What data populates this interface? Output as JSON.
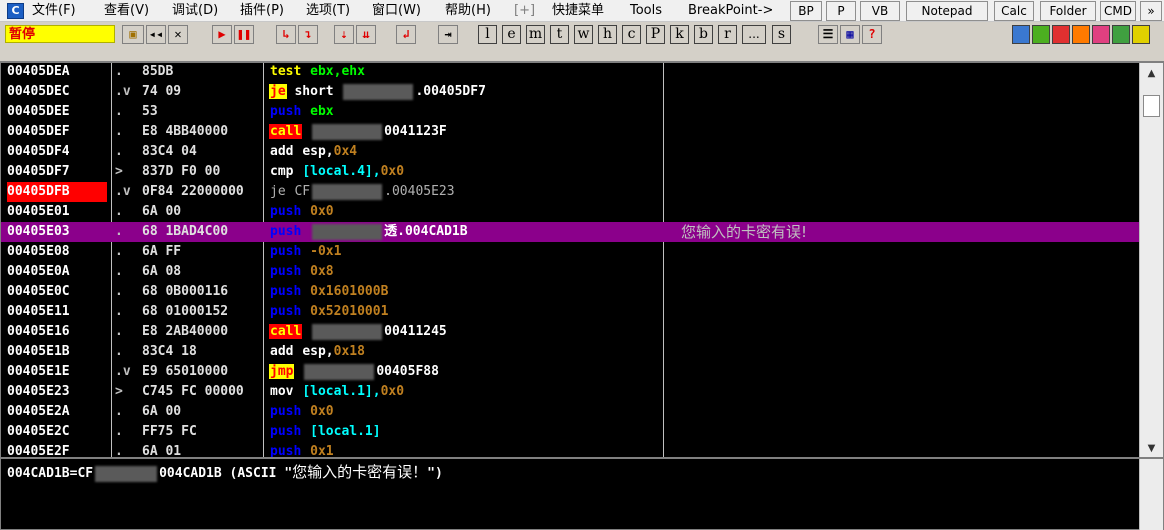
{
  "menubar": {
    "app_icon": "C",
    "items": [
      "文件(F)",
      "查看(V)",
      "调试(D)",
      "插件(P)",
      "选项(T)",
      "窗口(W)",
      "帮助(H)",
      "[+]",
      "快捷菜单",
      "Tools",
      "BreakPoint->"
    ],
    "buttons": [
      "BP",
      "P",
      "VB",
      "Notepad",
      "Calc",
      "Folder",
      "CMD"
    ]
  },
  "toolbar": {
    "status": "暂停",
    "letters": [
      "l",
      "e",
      "m",
      "t",
      "w",
      "h",
      "c",
      "P",
      "k",
      "b",
      "r",
      "...",
      "s"
    ],
    "question": "?"
  },
  "disasm": {
    "rows": [
      {
        "addr": "00405DEA",
        "mark": ".",
        "hex": "85DB",
        "op": "test",
        "op_class": "op-test",
        "args": "ebx,ehx",
        "args_class": "args-green",
        "comment": ""
      },
      {
        "addr": "00405DEC",
        "mark": ".v",
        "hex": "74 09",
        "op": "je",
        "op_class": "op-je",
        "args": "short ",
        "args_suffix": ".00405DF7",
        "args_class": "args",
        "redacted": true,
        "comment": ""
      },
      {
        "addr": "00405DEE",
        "mark": ".",
        "hex": "53",
        "op": "push",
        "op_class": "op-push",
        "args": "ebx",
        "args_class": "args-green",
        "comment": ""
      },
      {
        "addr": "00405DEF",
        "mark": ".",
        "hex": "E8 4BB40000",
        "op": "call",
        "op_class": "op-call",
        "args": "",
        "args_suffix": "0041123F",
        "args_class": "args",
        "redacted": true,
        "comment": ""
      },
      {
        "addr": "00405DF4",
        "mark": ".",
        "hex": "83C4 04",
        "op": "add",
        "op_class": "op-plain",
        "args": "esp,",
        "args_num": "0x4",
        "args_class": "args",
        "comment": ""
      },
      {
        "addr": "00405DF7",
        "mark": ">",
        "hex": "837D F0 00",
        "op": "cmp",
        "op_class": "op-plain",
        "args": "[local.4],",
        "args_num": "0x0",
        "args_class": "args-cyan",
        "comment": ""
      },
      {
        "addr": "00405DFB",
        "mark": ".v",
        "hex": "0F84 22000000",
        "op": "je",
        "op_class": "op-dim",
        "args": "CF",
        "args_suffix": ".00405E23",
        "args_class": "op-dim",
        "redacted": true,
        "comment": ""
      },
      {
        "addr": "00405E01",
        "mark": ".",
        "hex": "6A 00",
        "op": "push",
        "op_class": "op-push",
        "args": "",
        "args_num": "0x0",
        "args_class": "args",
        "comment": ""
      },
      {
        "addr": "00405E03",
        "mark": ".",
        "hex": "68 1BAD4C00",
        "op": "push",
        "op_class": "op-push",
        "args": "",
        "args_suffix": "透.004CAD1B",
        "args_class": "args",
        "redacted": true,
        "comment": "您输入的卡密有误!"
      },
      {
        "addr": "00405E08",
        "mark": ".",
        "hex": "6A FF",
        "op": "push",
        "op_class": "op-push",
        "args": "",
        "args_num": "-0x1",
        "args_class": "args",
        "comment": ""
      },
      {
        "addr": "00405E0A",
        "mark": ".",
        "hex": "6A 08",
        "op": "push",
        "op_class": "op-push",
        "args": "",
        "args_num": "0x8",
        "args_class": "args",
        "comment": ""
      },
      {
        "addr": "00405E0C",
        "mark": ".",
        "hex": "68 0B000116",
        "op": "push",
        "op_class": "op-push",
        "args": "",
        "args_num": "0x1601000B",
        "args_class": "args",
        "comment": ""
      },
      {
        "addr": "00405E11",
        "mark": ".",
        "hex": "68 01000152",
        "op": "push",
        "op_class": "op-push",
        "args": "",
        "args_num": "0x52010001",
        "args_class": "args",
        "comment": ""
      },
      {
        "addr": "00405E16",
        "mark": ".",
        "hex": "E8 2AB40000",
        "op": "call",
        "op_class": "op-call",
        "args": "",
        "args_suffix": "00411245",
        "args_class": "args",
        "redacted": true,
        "comment": ""
      },
      {
        "addr": "00405E1B",
        "mark": ".",
        "hex": "83C4 18",
        "op": "add",
        "op_class": "op-plain",
        "args": "esp,",
        "args_num": "0x18",
        "args_class": "args",
        "comment": ""
      },
      {
        "addr": "00405E1E",
        "mark": ".v",
        "hex": "E9 65010000",
        "op": "jmp",
        "op_class": "op-jmp",
        "args": "",
        "args_suffix": "00405F88",
        "args_class": "args",
        "redacted": true,
        "comment": ""
      },
      {
        "addr": "00405E23",
        "mark": ">",
        "hex": "C745 FC 00000",
        "op": "mov",
        "op_class": "op-plain",
        "args": "[local.1],",
        "args_num": "0x0",
        "args_class": "args-cyan",
        "comment": ""
      },
      {
        "addr": "00405E2A",
        "mark": ".",
        "hex": "6A 00",
        "op": "push",
        "op_class": "op-push",
        "args": "",
        "args_num": "0x0",
        "args_class": "args",
        "comment": ""
      },
      {
        "addr": "00405E2C",
        "mark": ".",
        "hex": "FF75 FC",
        "op": "push",
        "op_class": "op-push",
        "args": "[local.1]",
        "args_class": "args-cyan",
        "comment": ""
      },
      {
        "addr": "00405E2F",
        "mark": ".",
        "hex": "6A 01",
        "op": "push",
        "op_class": "op-push",
        "args": "",
        "args_num": "0x1",
        "args_class": "args",
        "comment": ""
      }
    ]
  },
  "info": {
    "line_prefix": "004CAD1B=CF",
    "line_mid": "004CAD1B (ASCII \"",
    "line_cjk": "您输入的卡密有误！",
    "line_end": "\")"
  }
}
